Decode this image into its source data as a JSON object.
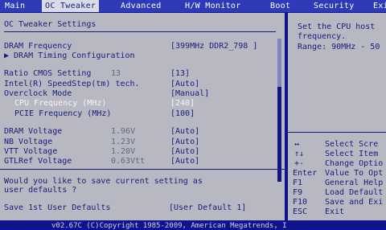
{
  "menu": {
    "tabs": [
      {
        "label": "Main"
      },
      {
        "label": "OC Tweaker"
      },
      {
        "label": "Advanced"
      },
      {
        "label": "H/W Monitor"
      },
      {
        "label": "Boot"
      },
      {
        "label": "Security"
      },
      {
        "label": "Exit"
      }
    ]
  },
  "main": {
    "title": "OC Tweaker Settings",
    "dram_frequency": {
      "label": "DRAM Frequency",
      "value": "[399MHz DDR2_798  ]"
    },
    "dram_timing": {
      "label": "▶ DRAM Timing Configuration"
    },
    "ratio_cmos": {
      "label": "Ratio CMOS Setting",
      "current": "13",
      "value": "[13]"
    },
    "speedstep": {
      "label": "Intel(R) SpeedStep(tm) tech.",
      "value": "[Auto]"
    },
    "overclock": {
      "label": "Overclock Mode",
      "value": "[Manual]"
    },
    "cpu_freq": {
      "label": "CPU Frequency (MHz)",
      "value": "[240]"
    },
    "pcie_freq": {
      "label": "PCIE Frequency (MHz)",
      "value": "[100]"
    },
    "dram_voltage": {
      "label": "DRAM Voltage",
      "current": "1.96V",
      "value": "[Auto]"
    },
    "nb_voltage": {
      "label": "NB Voltage",
      "current": "1.23V",
      "value": "[Auto]"
    },
    "vtt_voltage": {
      "label": "VTT Voltage",
      "current": "1.20V",
      "value": "[Auto]"
    },
    "gtlref_voltage": {
      "label": "GTLRef Voltage",
      "current": "0.63Vtt",
      "value": "[Auto]"
    },
    "prompt_line1": "Would you like to save current setting as",
    "prompt_line2": "user defaults ?",
    "save_user_defaults": {
      "label": "Save 1st User Defaults",
      "value": "[User Default  1]"
    }
  },
  "help": {
    "line1": "Set the CPU host",
    "line2": "frequency.",
    "line3": "Range: 90MHz - 50",
    "keys": [
      {
        "key": "↔",
        "desc": "Select Scre"
      },
      {
        "key": "↑↓",
        "desc": "Select Item"
      },
      {
        "key": "+-",
        "desc": "Change Optio"
      },
      {
        "key": "Enter",
        "desc": "Value To Opt"
      },
      {
        "key": "F1",
        "desc": "General Help"
      },
      {
        "key": "F9",
        "desc": "Load Default"
      },
      {
        "key": "F10",
        "desc": "Save and Exi"
      },
      {
        "key": "ESC",
        "desc": "Exit"
      }
    ]
  },
  "status": {
    "text": "v02.67C (C)Copyright 1985-2009, American Megatrends, I"
  },
  "colors": {
    "background": "#10148a",
    "panel": "#b7b8c2",
    "text": "#1a1c7a",
    "highlight": "#f4f5fa"
  }
}
